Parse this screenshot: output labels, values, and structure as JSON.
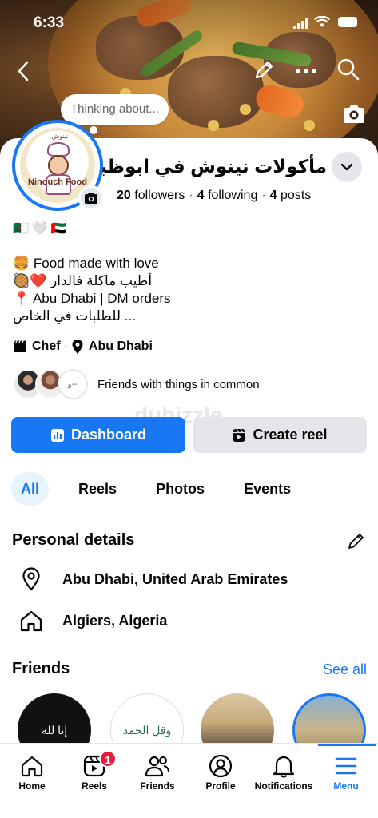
{
  "status_bar": {
    "time": "6:33"
  },
  "cover": {
    "thought_bubble": "Thinking about..."
  },
  "profile": {
    "avatar_brand": "Ninouch Food",
    "avatar_topline": "نينوش",
    "name": "مأكولات نينوش في ابوظبي",
    "followers_count": "20",
    "followers_label": "followers",
    "following_count": "4",
    "following_label": "following",
    "posts_count": "4",
    "posts_label": "posts",
    "flags": "🇩🇿🤍🇦🇪",
    "bio": [
      "🍔 Food made with love",
      "🥘❤️ أطيب ماكلة فالدار",
      "📍 Abu Dhabi | DM orders",
      "للطلبات في الخاص ..."
    ],
    "category": "Chef",
    "location": "Abu Dhabi",
    "mutual_text": "Friends with things in common"
  },
  "watermark": "dubizzle",
  "actions": {
    "dashboard_label": "Dashboard",
    "create_reel_label": "Create reel"
  },
  "tabs": [
    {
      "label": "All",
      "active": true
    },
    {
      "label": "Reels",
      "active": false
    },
    {
      "label": "Photos",
      "active": false
    },
    {
      "label": "Events",
      "active": false
    }
  ],
  "personal_details": {
    "title": "Personal details",
    "items": [
      {
        "icon": "location-pin-icon",
        "text": "Abu Dhabi, United Arab Emirates"
      },
      {
        "icon": "home-icon",
        "text": "Algiers, Algeria"
      }
    ]
  },
  "friends": {
    "title": "Friends",
    "see_all": "See all"
  },
  "bottom_nav": [
    {
      "label": "Home",
      "icon": "home-icon"
    },
    {
      "label": "Reels",
      "icon": "reels-icon",
      "badge": "1"
    },
    {
      "label": "Friends",
      "icon": "friends-icon"
    },
    {
      "label": "Profile",
      "icon": "profile-icon"
    },
    {
      "label": "Notifications",
      "icon": "bell-icon"
    },
    {
      "label": "Menu",
      "icon": "menu-icon",
      "active": true
    }
  ],
  "colors": {
    "accent": "#1877f2",
    "badge": "#e41e3f",
    "secondary_button": "#e4e6eb"
  }
}
